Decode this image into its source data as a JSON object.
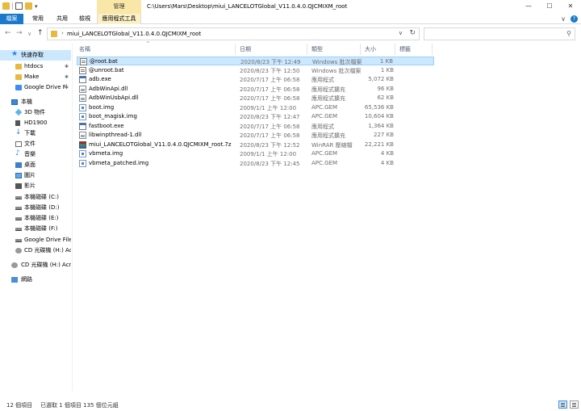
{
  "titlebar": {
    "manage_tab": "管理",
    "path_title": "C:\\Users\\Mars\\Desktop\\miui_LANCELOTGlobal_V11.0.4.0.QJCMIXM_root",
    "minimize": "—",
    "maximize": "☐",
    "close": "✕"
  },
  "ribbon": {
    "tabs": {
      "file": "檔案",
      "home": "常用",
      "share": "共用",
      "view": "檢視",
      "app_tools": "應用程式工具"
    },
    "collapse": "∨",
    "help": "?"
  },
  "nav": {
    "back": "←",
    "forward": "→",
    "recent": "∨",
    "up": "↑",
    "address_chevron": "›",
    "address_path": "miui_LANCELOTGlobal_V11.0.4.0.QJCMIXM_root",
    "address_dropdown": "∨",
    "refresh": "↻",
    "search_placeholder": "",
    "search_icon": "⚲"
  },
  "sidebar": {
    "items": [
      {
        "label": "快速存取",
        "icon": "star-icon"
      },
      {
        "label": "htdocs",
        "icon": "folder-icon",
        "pinned": "✱"
      },
      {
        "label": "Make",
        "icon": "folder-icon",
        "pinned": "✱"
      },
      {
        "label": "Google Drive Fi",
        "icon": "google-drive-icon",
        "pinned": "✱"
      },
      {
        "label": "本機",
        "icon": "this-pc-icon"
      },
      {
        "label": "3D 物件",
        "icon": "3d-objects-icon"
      },
      {
        "label": "HD1900",
        "icon": "phone-icon"
      },
      {
        "label": "下載",
        "icon": "download-icon"
      },
      {
        "label": "文件",
        "icon": "documents-icon"
      },
      {
        "label": "音樂",
        "icon": "music-icon"
      },
      {
        "label": "桌面",
        "icon": "desktop-icon"
      },
      {
        "label": "圖片",
        "icon": "pictures-icon"
      },
      {
        "label": "影片",
        "icon": "videos-icon"
      },
      {
        "label": "本機磁碟 (C:)",
        "icon": "disk-icon"
      },
      {
        "label": "本機磁碟 (D:)",
        "icon": "disk-icon"
      },
      {
        "label": "本機磁碟 (E:)",
        "icon": "disk-icon"
      },
      {
        "label": "本機磁碟 (F:)",
        "icon": "disk-icon"
      },
      {
        "label": "Google Drive File S",
        "icon": "google-drive-icon"
      },
      {
        "label": "CD 光碟機 (H:) Acro",
        "icon": "cd-drive-icon"
      },
      {
        "label": "CD 光碟機 (H:) Acro",
        "icon": "cd-drive-icon"
      },
      {
        "label": "網路",
        "icon": "network-icon"
      }
    ]
  },
  "filelist": {
    "columns": {
      "name": "名稱",
      "date": "日期",
      "type": "類型",
      "size": "大小",
      "tags": "標籤"
    },
    "sort_indicator": "^",
    "rows": [
      {
        "name": "@root.bat",
        "date": "2020/8/23 下午 12:49",
        "type": "Windows 批次檔案",
        "size": "1 KB",
        "icon": "batch-file-icon"
      },
      {
        "name": "@unroot.bat",
        "date": "2020/8/23 下午 12:50",
        "type": "Windows 批次檔案",
        "size": "1 KB",
        "icon": "batch-file-icon"
      },
      {
        "name": "adb.exe",
        "date": "2020/7/17 上午 06:58",
        "type": "應用程式",
        "size": "5,072 KB",
        "icon": "exe-file-icon"
      },
      {
        "name": "AdbWinApi.dll",
        "date": "2020/7/17 上午 06:58",
        "type": "應用程式擴充",
        "size": "96 KB",
        "icon": "dll-file-icon"
      },
      {
        "name": "AdbWinUsbApi.dll",
        "date": "2020/7/17 上午 06:58",
        "type": "應用程式擴充",
        "size": "62 KB",
        "icon": "dll-file-icon"
      },
      {
        "name": "boot.img",
        "date": "2009/1/1 上午 12:00",
        "type": "APC.GEM",
        "size": "65,536 KB",
        "icon": "img-file-icon"
      },
      {
        "name": "boot_magisk.img",
        "date": "2020/8/23 下午 12:47",
        "type": "APC.GEM",
        "size": "10,604 KB",
        "icon": "img-file-icon"
      },
      {
        "name": "fastboot.exe",
        "date": "2020/7/17 上午 06:58",
        "type": "應用程式",
        "size": "1,364 KB",
        "icon": "exe-file-icon"
      },
      {
        "name": "libwinpthread-1.dll",
        "date": "2020/7/17 上午 06:58",
        "type": "應用程式擴充",
        "size": "227 KB",
        "icon": "dll-file-icon"
      },
      {
        "name": "miui_LANCELOTGlobal_V11.0.4.0.QJCMIXM_root.7z",
        "date": "2020/8/23 下午 12:52",
        "type": "WinRAR 壓縮檔",
        "size": "22,221 KB",
        "icon": "winrar-archive-icon"
      },
      {
        "name": "vbmeta.img",
        "date": "2009/1/1 上午 12:00",
        "type": "APC.GEM",
        "size": "4 KB",
        "icon": "img-file-icon"
      },
      {
        "name": "vbmeta_patched.img",
        "date": "2020/8/23 下午 12:45",
        "type": "APC.GEM",
        "size": "4 KB",
        "icon": "img-file-icon"
      }
    ]
  },
  "status": {
    "item_count": "12 個項目",
    "selection": "已選取 1 個項目  135 個位元組"
  },
  "colors": {
    "accent": "#1979ca",
    "selection": "#cce8ff",
    "manage_tab": "#f9e7a7"
  }
}
